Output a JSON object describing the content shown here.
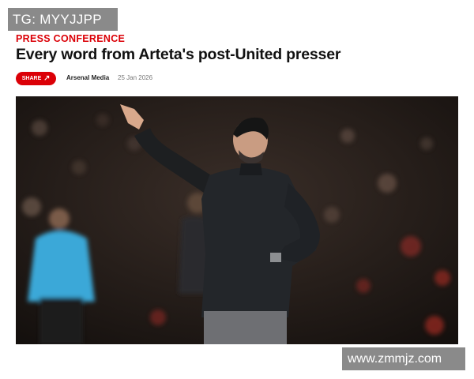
{
  "watermarks": {
    "top_left": "TG: MYYJJPP",
    "bottom_right": "www.zmmjz.com"
  },
  "article": {
    "category": "PRESS CONFERENCE",
    "headline": "Every word from Arteta's post-United presser",
    "share_label": "SHARE",
    "publisher": "Arsenal Media",
    "date": "25 Jan 2026"
  },
  "colors": {
    "accent": "#db0007",
    "watermark_bg": "#8a8a8a"
  },
  "icons": {
    "share": "share-arrow-icon"
  }
}
